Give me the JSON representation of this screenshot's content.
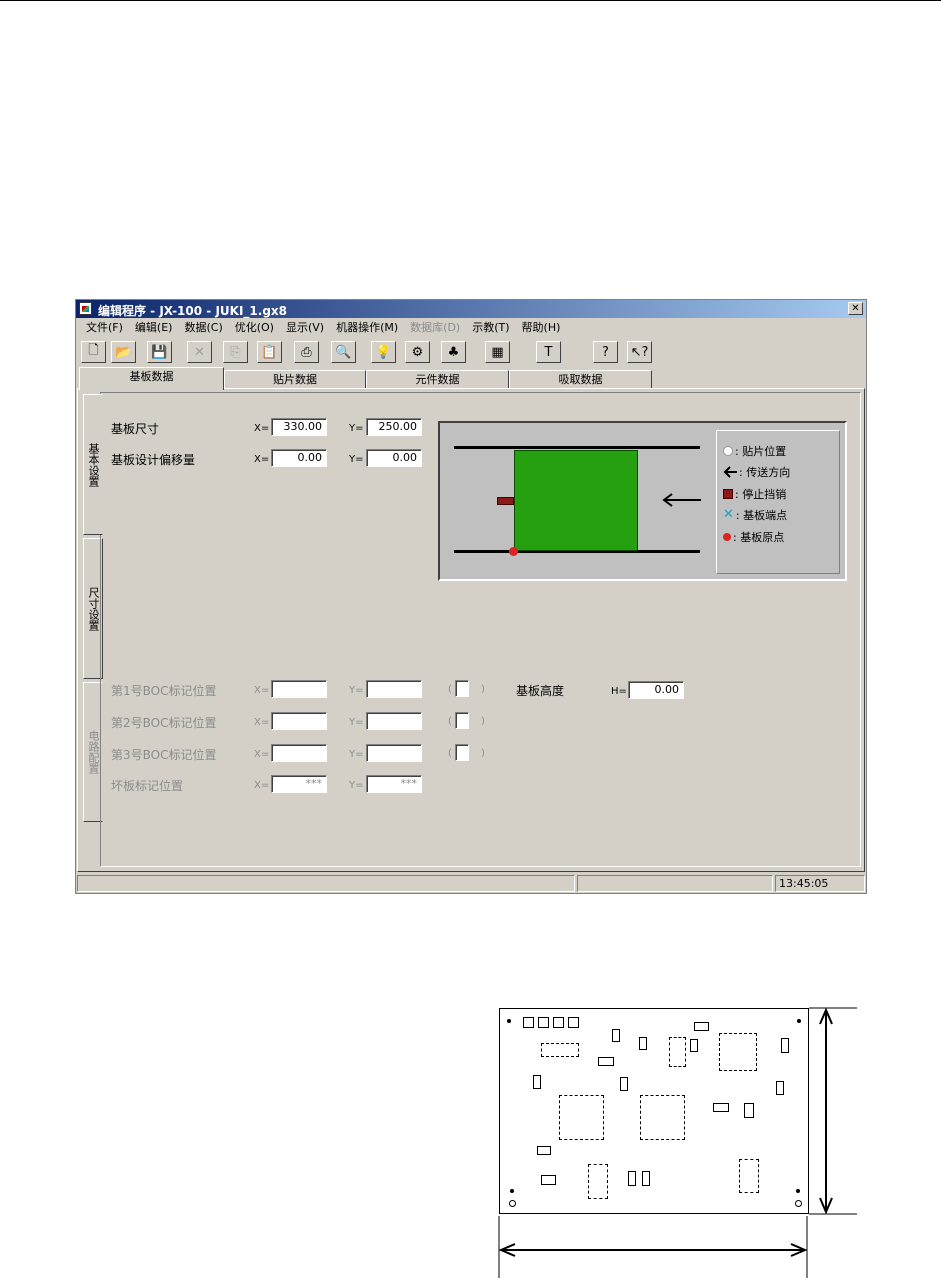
{
  "window": {
    "title": "编辑程序  - JX-100 - JUKI_1.gx8",
    "close_glyph": "✕"
  },
  "menu": [
    "文件(F)",
    "编辑(E)",
    "数据(C)",
    "优化(O)",
    "显示(V)",
    "机器操作(M)",
    "数据库(D)",
    "示教(T)",
    "帮助(H)"
  ],
  "menu_disabled": [
    6
  ],
  "toolbar": [
    {
      "icon": "new-file-icon",
      "glyph": "🗋"
    },
    {
      "icon": "open-folder-icon",
      "glyph": "📂"
    },
    {
      "icon": "save-icon",
      "glyph": "💾"
    },
    {
      "icon": "cut-icon",
      "glyph": "✕"
    },
    {
      "icon": "copy-icon",
      "glyph": "⎘"
    },
    {
      "icon": "paste-icon",
      "glyph": "📋"
    },
    {
      "icon": "print-icon",
      "glyph": "⎙"
    },
    {
      "icon": "binoculars-icon",
      "glyph": "🔍"
    },
    {
      "icon": "lightbulb-icon",
      "glyph": "💡"
    },
    {
      "icon": "machine-icon",
      "glyph": "⚙"
    },
    {
      "icon": "parts-icon",
      "glyph": "♣"
    },
    {
      "icon": "board-icon",
      "glyph": "▦"
    },
    {
      "icon": "text-icon",
      "glyph": "T"
    },
    {
      "icon": "help-icon",
      "glyph": "?"
    },
    {
      "icon": "context-help-icon",
      "glyph": "↖?"
    }
  ],
  "tabs": [
    "基板数据",
    "贴片数据",
    "元件数据",
    "吸取数据"
  ],
  "side_tabs": [
    "基本设置",
    "尺寸设置",
    "电路配置"
  ],
  "board": {
    "size_label": "基板尺寸",
    "size_x": "330.00",
    "size_y": "250.00",
    "offset_label": "基板设计偏移量",
    "offset_x": "0.00",
    "offset_y": "0.00",
    "x_prefix": "X=",
    "y_prefix": "Y=",
    "h_prefix": "H=",
    "height_label": "基板高度",
    "height": "0.00"
  },
  "marks": [
    {
      "label": "第1号BOC标记位置",
      "x": "",
      "y": ""
    },
    {
      "label": "第2号BOC标记位置",
      "x": "",
      "y": ""
    },
    {
      "label": "第3号BOC标记位置",
      "x": "",
      "y": ""
    }
  ],
  "bad_mark": {
    "label": "坏板标记位置",
    "x": "***",
    "y": "***"
  },
  "paren_open": "(",
  "paren_close": ")",
  "legend": [
    {
      "icon": "placement-dot-icon",
      "text": ": 贴片位置"
    },
    {
      "icon": "arrow-left-icon",
      "text": ": 传送方向"
    },
    {
      "icon": "stop-pin-icon",
      "text": ": 停止挡销"
    },
    {
      "icon": "board-edge-icon",
      "text": ": 基板端点"
    },
    {
      "icon": "origin-dot-icon",
      "text": ": 基板原点"
    }
  ],
  "status": {
    "time": "13:45:05"
  },
  "colors": {
    "board_green": "#24a010",
    "title_blue": "#0a246a",
    "stop_pin": "#8b1a1a",
    "origin": "#dd2222"
  }
}
